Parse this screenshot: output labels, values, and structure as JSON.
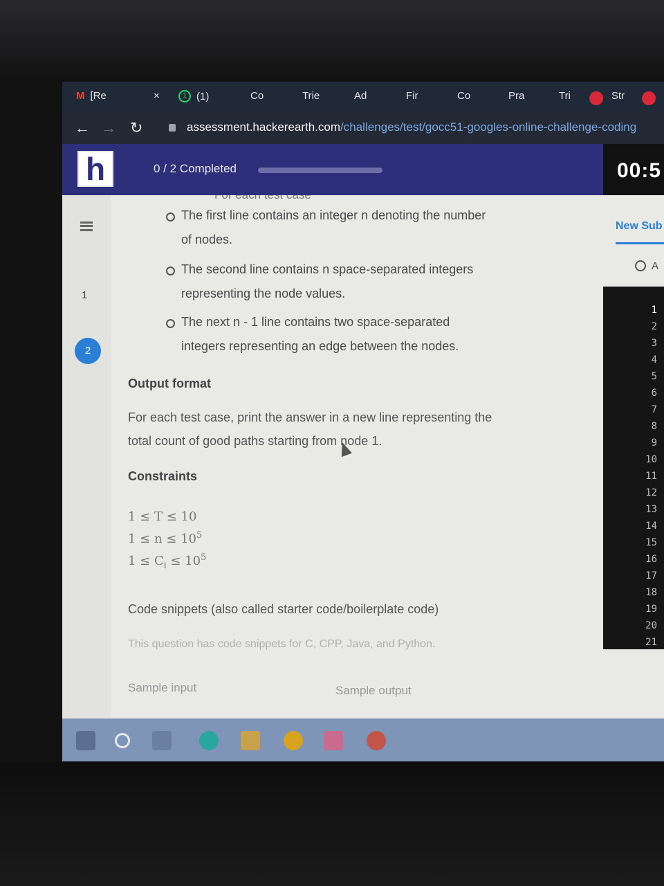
{
  "browser": {
    "tabs": [
      {
        "label": "[Re",
        "icon": "gmail-icon"
      },
      {
        "label": "(1)",
        "icon": "whatsapp-icon"
      },
      {
        "label": "Co"
      },
      {
        "label": "Trie"
      },
      {
        "label": "Ad"
      },
      {
        "label": "Fir"
      },
      {
        "label": "Co"
      },
      {
        "label": "Pra"
      },
      {
        "label": "Tri"
      },
      {
        "label": "Str"
      }
    ],
    "close_glyph": "×",
    "wa_badge": "1",
    "url_domain": "assessment.hackerearth.com",
    "url_path": "/challenges/test/gocc51-googles-online-challenge-coding"
  },
  "header": {
    "logo": "h",
    "progress_label": "0 / 2 Completed",
    "progress_fraction": 0,
    "timer": "00:5"
  },
  "sidebar": {
    "questions": [
      "1",
      "2"
    ],
    "active_question": "2"
  },
  "problem": {
    "cut_heading": "For each test case",
    "bullets": [
      [
        "The first line contains an integer n denoting the number",
        "of nodes."
      ],
      [
        "The second line contains n space-separated integers",
        "representing the node values."
      ],
      [
        "The next n - 1 line contains two space-separated",
        "integers representing an edge between the nodes."
      ]
    ],
    "output_heading": "Output format",
    "output_text_1": "For each test case, print the answer in a new line representing the",
    "output_text_2": "total count of good paths starting from node 1.",
    "constraints_heading": "Constraints",
    "constraints": [
      "1 ≤ T ≤ 10",
      "1 ≤ n ≤ 10",
      "1 ≤ C",
      " ≤ 10"
    ],
    "constraint_exp": "5",
    "constraint_sub": "i",
    "snippets_heading": "Code snippets (also called starter code/boilerplate code)",
    "snippets_text": "This question has code snippets for C, CPP, Java, and Python.",
    "sample_input_label": "Sample input",
    "sample_output_label": "Sample output"
  },
  "right_panel": {
    "new_submission": "New Sub",
    "clock_label": "A",
    "line_numbers": [
      "1",
      "2",
      "3",
      "4",
      "5",
      "6",
      "7",
      "8",
      "9",
      "10",
      "11",
      "12",
      "13",
      "14",
      "15",
      "16",
      "17",
      "18",
      "19",
      "20",
      "21"
    ]
  }
}
